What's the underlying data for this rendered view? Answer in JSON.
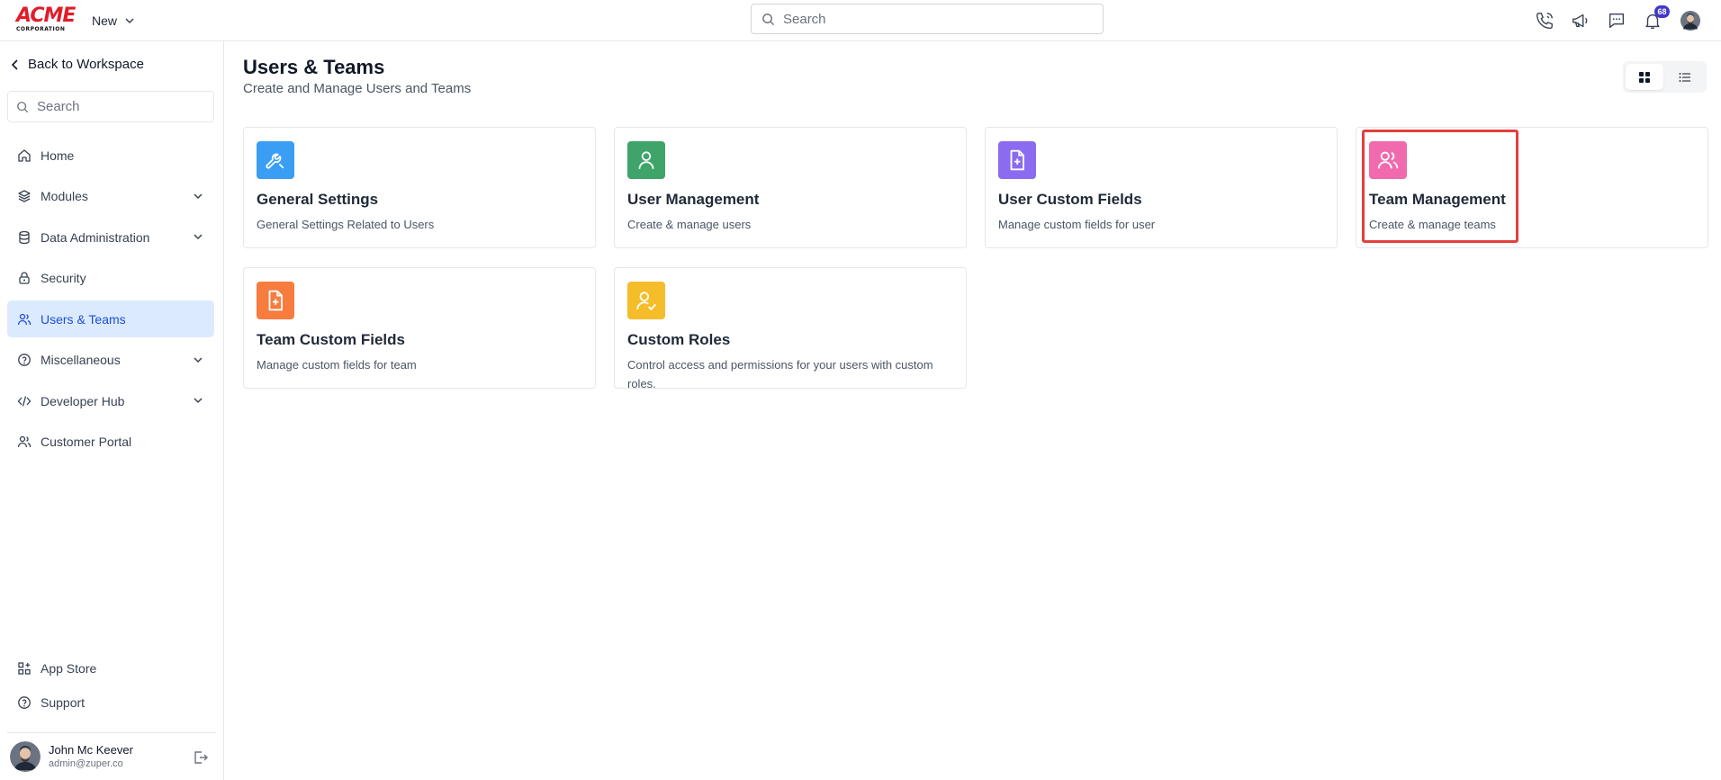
{
  "app": {
    "logo_text": "ACME",
    "logo_subtext": "CORPORATION",
    "new_label": "New",
    "search_placeholder": "Search",
    "notification_count": "68"
  },
  "sidebar": {
    "back_label": "Back to Workspace",
    "search_placeholder": "Search",
    "items": [
      {
        "label": "Home",
        "icon": "home-icon",
        "expandable": false,
        "active": false
      },
      {
        "label": "Modules",
        "icon": "layers-icon",
        "expandable": true,
        "active": false
      },
      {
        "label": "Data Administration",
        "icon": "database-icon",
        "expandable": true,
        "active": false
      },
      {
        "label": "Security",
        "icon": "lock-icon",
        "expandable": false,
        "active": false
      },
      {
        "label": "Users & Teams",
        "icon": "users-icon",
        "expandable": false,
        "active": true
      },
      {
        "label": "Miscellaneous",
        "icon": "help-circle-icon",
        "expandable": true,
        "active": false
      },
      {
        "label": "Developer Hub",
        "icon": "code-icon",
        "expandable": true,
        "active": false
      },
      {
        "label": "Customer Portal",
        "icon": "users-icon",
        "expandable": false,
        "active": false
      }
    ],
    "bottom": [
      {
        "label": "App Store",
        "icon": "app-grid-icon"
      },
      {
        "label": "Support",
        "icon": "help-circle-icon"
      }
    ],
    "user": {
      "name": "John Mc Keever",
      "email": "admin@zuper.co"
    }
  },
  "main": {
    "title": "Users & Teams",
    "subtitle": "Create and Manage Users and Teams",
    "view_mode": "grid",
    "cards": [
      {
        "title": "General Settings",
        "description": "General Settings Related to Users",
        "icon": "wrench-icon",
        "color": "#3b9ef5"
      },
      {
        "title": "User Management",
        "description": "Create & manage users",
        "icon": "user-icon",
        "color": "#3fa46a"
      },
      {
        "title": "User Custom Fields",
        "description": "Manage custom fields for user",
        "icon": "file-plus-icon",
        "color": "#8b6cf0"
      },
      {
        "title": "Team Management",
        "description": "Create & manage teams",
        "icon": "users-icon",
        "color": "#f06aad"
      },
      {
        "title": "Team Custom Fields",
        "description": "Manage custom fields for team",
        "icon": "file-plus-icon",
        "color": "#f77c3e"
      },
      {
        "title": "Custom Roles",
        "description": "Control access and permissions for your users with custom roles.",
        "icon": "user-check-icon",
        "color": "#f6bd2b"
      }
    ]
  },
  "colors": {
    "accent": "#1d4ed8",
    "active_bg": "#dbeafe",
    "highlight": "#e53e3e",
    "logo_red": "#e11d2a"
  }
}
